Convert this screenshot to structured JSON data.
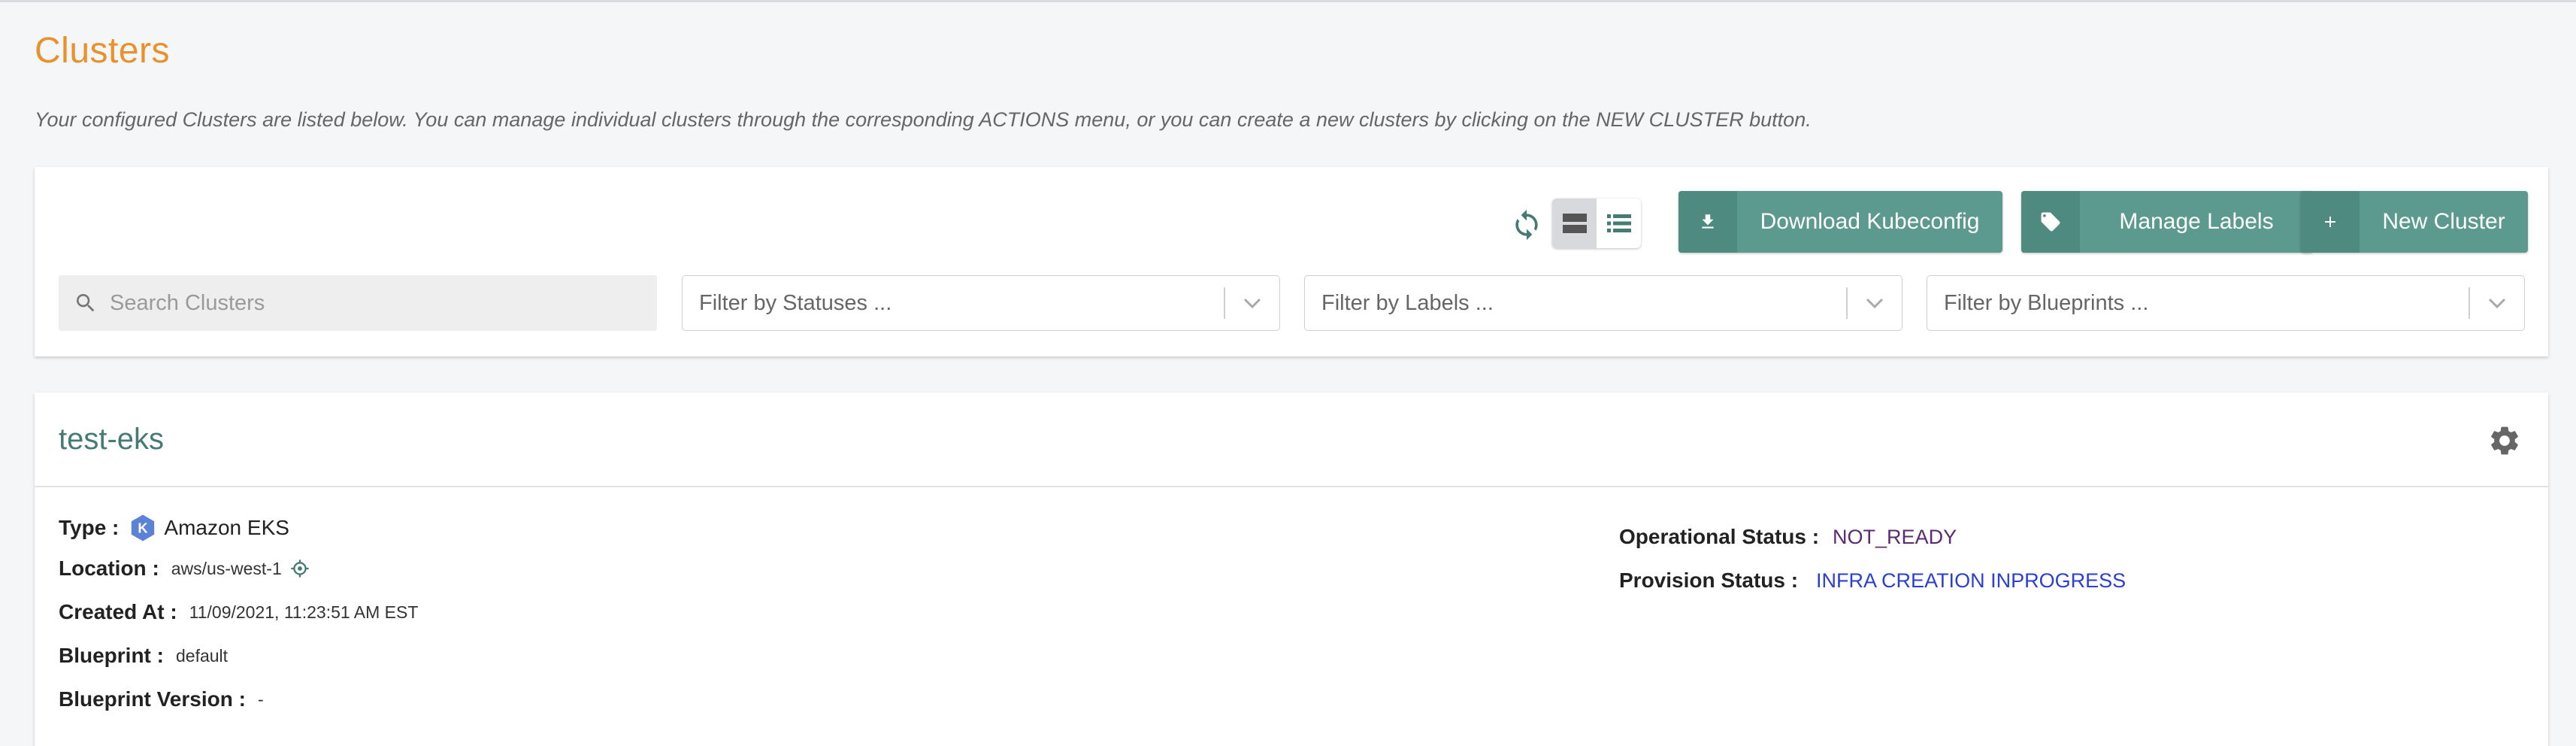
{
  "page": {
    "title": "Clusters",
    "subtitle": "Your configured Clusters are listed below. You can manage individual clusters through the corresponding ACTIONS menu, or you can create a new clusters by clicking on the NEW CLUSTER button."
  },
  "toolbar": {
    "refresh_icon": "refresh-icon",
    "view_modes": [
      "card-view-icon",
      "list-view-icon"
    ],
    "active_view": "card-view-icon",
    "download_label": "Download Kubeconfig",
    "manage_labels_label": "Manage Labels",
    "new_cluster_label": "New Cluster",
    "accent_color": "#5c9a8f"
  },
  "filters": {
    "search_placeholder": "Search Clusters",
    "statuses_placeholder": "Filter by Statuses ...",
    "labels_placeholder": "Filter by Labels ...",
    "blueprints_placeholder": "Filter by Blueprints ..."
  },
  "cluster": {
    "name": "test-eks",
    "type_label": "Type :",
    "type_value": "Amazon EKS",
    "location_label": "Location :",
    "location_value": "aws/us-west-1",
    "created_label": "Created At :",
    "created_value": "11/09/2021, 11:23:51 AM EST",
    "blueprint_label": "Blueprint :",
    "blueprint_value": "default",
    "blueprint_version_label": "Blueprint Version :",
    "blueprint_version_value": "-",
    "operational_label": "Operational Status :",
    "operational_value": "NOT_READY",
    "provision_label": "Provision Status :",
    "provision_value": "INFRA CREATION INPROGRESS"
  }
}
